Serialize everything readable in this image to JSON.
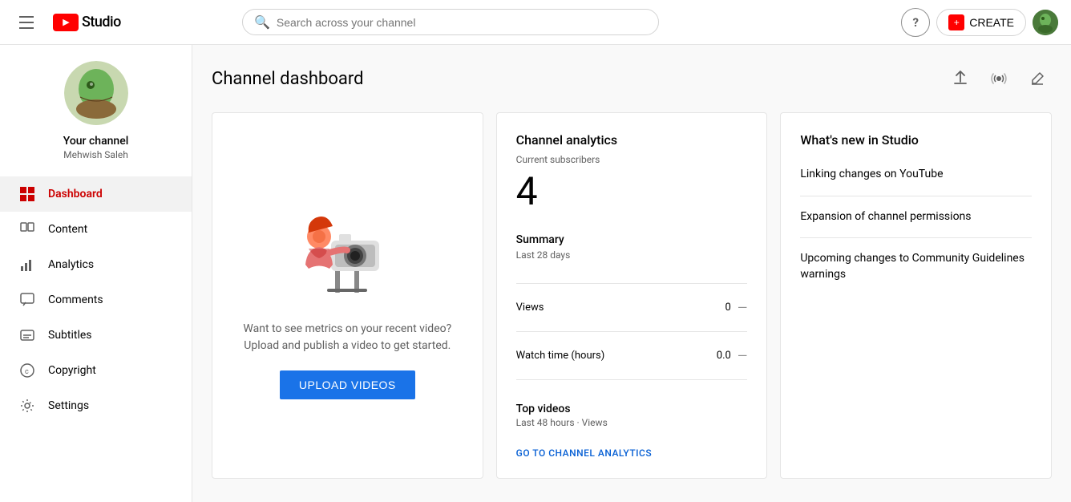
{
  "topbar": {
    "hamburger_label": "Menu",
    "logo_text": "Studio",
    "search_placeholder": "Search across your channel",
    "help_icon": "?",
    "create_label": "CREATE",
    "create_icon": "+"
  },
  "sidebar": {
    "channel_name": "Your channel",
    "channel_handle": "Mehwish Saleh",
    "nav_items": [
      {
        "id": "dashboard",
        "label": "Dashboard",
        "active": true
      },
      {
        "id": "content",
        "label": "Content",
        "active": false
      },
      {
        "id": "analytics",
        "label": "Analytics",
        "active": false
      },
      {
        "id": "comments",
        "label": "Comments",
        "active": false
      },
      {
        "id": "subtitles",
        "label": "Subtitles",
        "active": false
      },
      {
        "id": "copyright",
        "label": "Copyright",
        "active": false
      },
      {
        "id": "settings",
        "label": "Settings",
        "active": false
      }
    ]
  },
  "page": {
    "title": "Channel dashboard"
  },
  "upload_card": {
    "text_line1": "Want to see metrics on your recent video?",
    "text_line2": "Upload and publish a video to get started.",
    "button_label": "UPLOAD VIDEOS"
  },
  "analytics_card": {
    "title": "Channel analytics",
    "subscribers_label": "Current subscribers",
    "subscribers_count": "4",
    "summary_label": "Summary",
    "summary_period": "Last 28 days",
    "stats": [
      {
        "label": "Views",
        "value": "0",
        "change": "—"
      },
      {
        "label": "Watch time (hours)",
        "value": "0.0",
        "change": "—"
      }
    ],
    "top_videos_label": "Top videos",
    "top_videos_period": "Last 48 hours · Views",
    "analytics_link": "GO TO CHANNEL ANALYTICS"
  },
  "whats_new_card": {
    "title": "What's new in Studio",
    "items": [
      {
        "text": "Linking changes on YouTube"
      },
      {
        "text": "Expansion of channel permissions"
      },
      {
        "text": "Upcoming changes to Community Guidelines warnings"
      }
    ]
  }
}
